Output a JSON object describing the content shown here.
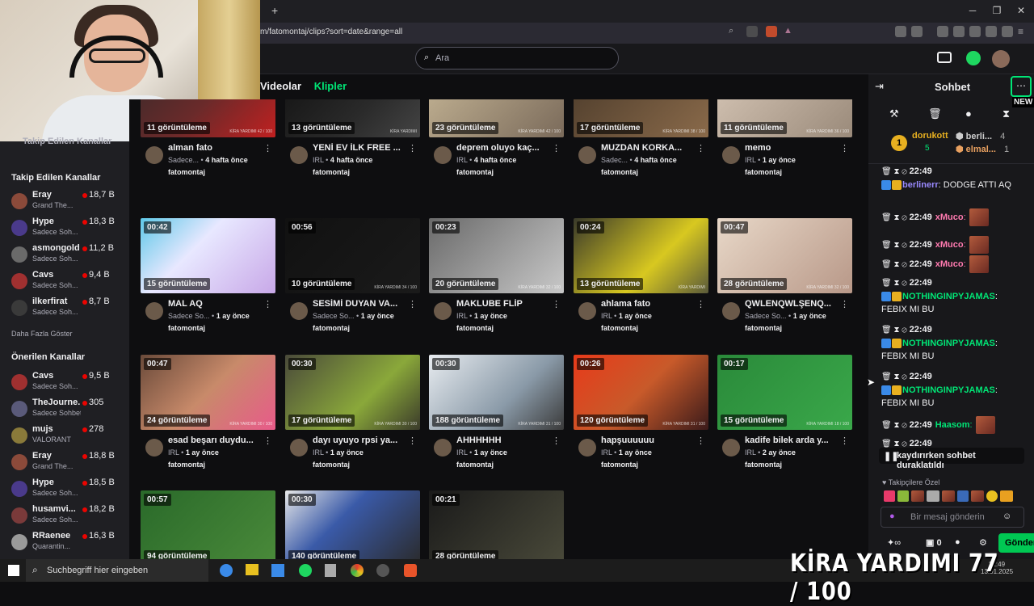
{
  "browser": {
    "url": "m/fatomontaj/clips?sort=date&range=all",
    "new_tab": "+"
  },
  "header": {
    "search_placeholder": "Ara"
  },
  "tabs": {
    "videos": "Videolar",
    "clips": "Klipler"
  },
  "sidebar": {
    "cut_heading": "Takip Edilen Kanallar",
    "followed_heading": "Takip Edilen Kanallar",
    "followed": [
      {
        "name": "Eray",
        "game": "Grand The...",
        "viewers": "18,7 B",
        "color": "#8b4a3a"
      },
      {
        "name": "Hype",
        "game": "Sadece Soh...",
        "viewers": "18,3 B",
        "color": "#4a3a8b"
      },
      {
        "name": "asmongold",
        "game": "Sadece Soh...",
        "viewers": "11,2 B",
        "color": "#6a6a6a"
      },
      {
        "name": "Cavs",
        "game": "Sadece Soh...",
        "viewers": "9,4 B",
        "color": "#a03030"
      },
      {
        "name": "ilkerfirat",
        "game": "Sadece Soh...",
        "viewers": "8,7 B",
        "color": "#3a3a3a"
      }
    ],
    "show_more": "Daha Fazla Göster",
    "recommended_heading": "Önerilen Kanallar",
    "recommended": [
      {
        "name": "Cavs",
        "game": "Sadece Soh...",
        "viewers": "9,5 B",
        "color": "#a03030"
      },
      {
        "name": "TheJourne...",
        "game": "Sadece Sohbet",
        "viewers": "305",
        "color": "#5a5a7a"
      },
      {
        "name": "mujs",
        "game": "VALORANT",
        "viewers": "278",
        "color": "#8a7a3a"
      },
      {
        "name": "Eray",
        "game": "Grand The...",
        "viewers": "18,8 B",
        "color": "#8b4a3a"
      },
      {
        "name": "Hype",
        "game": "Sadece Soh...",
        "viewers": "18,5 B",
        "color": "#4a3a8b"
      },
      {
        "name": "husamvi...",
        "game": "Sadece Soh...",
        "viewers": "18,2 B",
        "color": "#7a3a3a"
      },
      {
        "name": "RRaenee",
        "game": "Quarantin...",
        "viewers": "16,3 B",
        "color": "#9a9a9a"
      }
    ]
  },
  "clips": [
    {
      "duration": "",
      "views": "11 görüntüleme",
      "title": "alman fato",
      "category": "Sadece...",
      "age": "4 hafta önce",
      "channel": "fatomontaj",
      "wm": "KİRA YARDIMI 42 / 100",
      "bg": "linear-gradient(135deg,#3a2a2a,#6a2a2a 50%,#c02020)"
    },
    {
      "duration": "",
      "views": "13 görüntüleme",
      "title": "YENİ EV İLK FREE ...",
      "category": "IRL",
      "age": "4 hafta önce",
      "channel": "fatomontaj",
      "wm": "KİRA YARDIMI",
      "bg": "linear-gradient(135deg,#111,#2a2a2a 60%,#444)"
    },
    {
      "duration": "",
      "views": "23 görüntüleme",
      "title": "deprem oluyo kaç...",
      "category": "IRL",
      "age": "4 hafta önce",
      "channel": "fatomontaj",
      "wm": "KİRA YARDIMI 42 / 100",
      "bg": "linear-gradient(135deg,#c8b898,#7a6a5a)"
    },
    {
      "duration": "",
      "views": "17 görüntüleme",
      "title": "MUZDAN KORKA...",
      "category": "Sadec...",
      "age": "4 hafta önce",
      "channel": "fatomontaj",
      "wm": "KİRA YARDIMI 38 / 100",
      "bg": "linear-gradient(135deg,#4a3a2a,#8a6a4a)"
    },
    {
      "duration": "",
      "views": "11 görüntüleme",
      "title": "memo",
      "category": "IRL",
      "age": "1 ay önce",
      "channel": "fatomontaj",
      "wm": "KİRA YARDIMI 36 / 100",
      "bg": "linear-gradient(135deg,#d8c8b8,#9a8a7a)"
    },
    {
      "duration": "00:42",
      "views": "15 görüntüleme",
      "title": "MAL AQ",
      "category": "Sadece So...",
      "age": "1 ay önce",
      "channel": "fatomontaj",
      "wm": "",
      "bg": "linear-gradient(135deg,#5ec8e8,#e8e8ff 40%,#c8a8e8)"
    },
    {
      "duration": "00:56",
      "views": "10 görüntüleme",
      "title": "SESİMİ DUYAN VA...",
      "category": "Sadece So...",
      "age": "1 ay önce",
      "channel": "fatomontaj",
      "wm": "KİRA YARDIMI 34 / 100",
      "bg": "linear-gradient(135deg,#111,#1a1a1a)"
    },
    {
      "duration": "00:23",
      "views": "20 görüntüleme",
      "title": "MAKLUBE FLİP",
      "category": "IRL",
      "age": "1 ay önce",
      "channel": "fatomontaj",
      "wm": "KİRA YARDIMI 32 / 100",
      "bg": "linear-gradient(135deg,#6a6a6a,#c8c8c8)"
    },
    {
      "duration": "00:24",
      "views": "13 görüntüleme",
      "title": "ahlama fato",
      "category": "IRL",
      "age": "1 ay önce",
      "channel": "fatomontaj",
      "wm": "KİRA YARDIMI",
      "bg": "linear-gradient(135deg,#3a3a2a,#d8c820 60%,#5a5a3a)"
    },
    {
      "duration": "00:47",
      "views": "28 görüntüleme",
      "title": "QWLENQWLŞENQ...",
      "category": "Sadece So...",
      "age": "1 ay önce",
      "channel": "fatomontaj",
      "wm": "KİRA YARDIMI 32 / 100",
      "bg": "linear-gradient(135deg,#e8d8c8,#b89888)"
    },
    {
      "duration": "00:47",
      "views": "24 görüntüleme",
      "title": "esad beşarı duydu...",
      "category": "IRL",
      "age": "1 ay önce",
      "channel": "fatomontaj",
      "wm": "KİRA YARDIMI 30 / 100",
      "bg": "linear-gradient(135deg,#6a4a3a,#c88a6a 50%,#e85a8a)"
    },
    {
      "duration": "00:30",
      "views": "17 görüntüleme",
      "title": "dayı uyuyo rpsi ya...",
      "category": "IRL",
      "age": "1 ay önce",
      "channel": "fatomontaj",
      "wm": "KİRA YARDIMI 30 / 100",
      "bg": "linear-gradient(135deg,#4a4a3a,#8aa83a 60%,#3a3a2a)"
    },
    {
      "duration": "00:30",
      "views": "188 görüntüleme",
      "title": "AHHHHHH",
      "category": "IRL",
      "age": "1 ay önce",
      "channel": "fatomontaj",
      "wm": "KİRA YARDIMI 31 / 100",
      "bg": "linear-gradient(135deg,#e8ecf0,#8a9aa8 60%,#3a3a3a)"
    },
    {
      "duration": "00:26",
      "views": "120 görüntüleme",
      "title": "hapşuuuuuu",
      "category": "IRL",
      "age": "1 ay önce",
      "channel": "fatomontaj",
      "wm": "KİRA YARDIMI 31 / 100",
      "bg": "linear-gradient(135deg,#e83a1a,#c85a2a 50%,#3a1a1a)"
    },
    {
      "duration": "00:17",
      "views": "15 görüntüleme",
      "title": "kadife bilek arda y...",
      "category": "IRL",
      "age": "2 ay önce",
      "channel": "fatomontaj",
      "wm": "KİRA YARDIMI 18 / 100",
      "bg": "linear-gradient(135deg,#2a8a3a,#3aa84a)"
    },
    {
      "duration": "00:57",
      "views": "94 görüntüleme",
      "title": "",
      "category": "",
      "age": "",
      "channel": "",
      "wm": "",
      "bg": "linear-gradient(135deg,#2a6a2a,#4a8a3a)"
    },
    {
      "duration": "00:30",
      "views": "140 görüntüleme",
      "title": "",
      "category": "",
      "age": "",
      "channel": "",
      "wm": "",
      "bg": "linear-gradient(135deg,#e8e8e8,#3a5aa8 40%,#2a2a2a)"
    },
    {
      "duration": "00:21",
      "views": "28 görüntüleme",
      "title": "",
      "category": "",
      "age": "",
      "channel": "",
      "wm": "",
      "bg": "linear-gradient(135deg,#1a1a1a,#4a4a3a)"
    }
  ],
  "chat": {
    "title": "Sohbet",
    "new_badge": "NEW",
    "gifter": {
      "rank": "1",
      "name": "dorukott",
      "count": "5"
    },
    "gifter2": [
      {
        "name": "berli...",
        "count": "4"
      },
      {
        "name": "elmal...",
        "count": "1"
      }
    ],
    "messages": [
      {
        "time": "22:49",
        "user": "berlinerr",
        "text": ": DODGE ATTI AQ",
        "color": "#9a8aff",
        "emote": false
      },
      {
        "time": "22:49",
        "user": "xMuco",
        "text": ":",
        "color": "#ff7ab0",
        "emote": true
      },
      {
        "time": "22:49",
        "user": "xMuco",
        "text": ":",
        "color": "#ff7ab0",
        "emote": true
      },
      {
        "time": "22:49",
        "user": "xMuco",
        "text": ":",
        "color": "#ff7ab0",
        "emote": true
      },
      {
        "time": "22:49",
        "user": "NOTHINGINPYJAMAS",
        "text": ": FEBIX MI BU",
        "color": "#00e676",
        "emote": false
      },
      {
        "time": "22:49",
        "user": "NOTHINGINPYJAMAS",
        "text": ": FEBIX MI BU",
        "color": "#00e676",
        "emote": false
      },
      {
        "time": "22:49",
        "user": "NOTHINGINPYJAMAS",
        "text": ": FEBIX MI BU",
        "color": "#00e676",
        "emote": false
      },
      {
        "time": "22:49",
        "user": "Haasom",
        "text": ":",
        "color": "#00e676",
        "emote": true
      },
      {
        "time": "22:49",
        "user": "",
        "text": "FEBIX MI BU",
        "color": "#00e676",
        "emote": false
      }
    ],
    "paused": "kaydırırken sohbet duraklatıldı",
    "followers_only": "Takipçilere Özel",
    "input_placeholder": "Bir mesaj gönderin",
    "points": "0",
    "send": "Gönder"
  },
  "taskbar": {
    "search": "Suchbegriff hier eingeben",
    "time": "22:49",
    "date": "13.01.2025"
  },
  "overlay": "KİRA YARDIMI 77 / 100"
}
